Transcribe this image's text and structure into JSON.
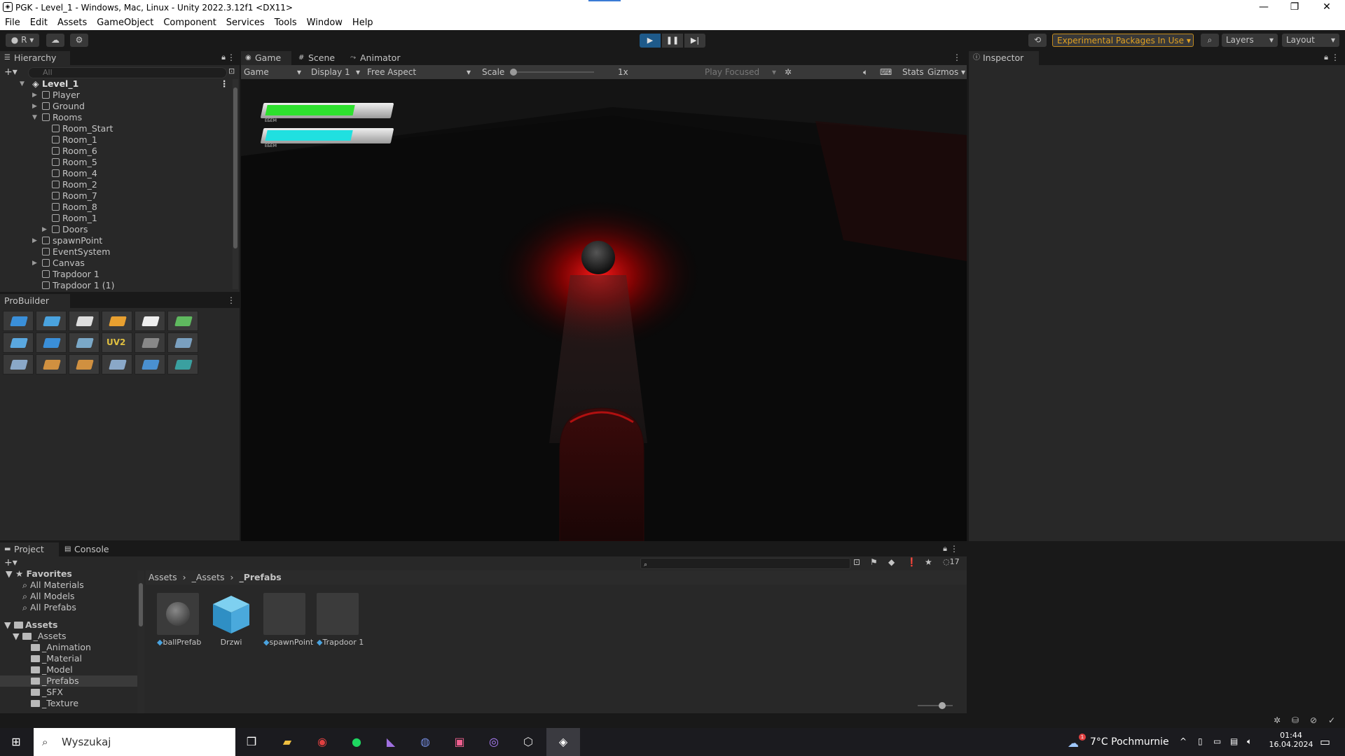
{
  "window": {
    "title": "PGK - Level_1 - Windows, Mac, Linux - Unity 2022.3.12f1 <DX11>",
    "minimize": "—",
    "restore": "❐",
    "close": "✕"
  },
  "menu": [
    "File",
    "Edit",
    "Assets",
    "GameObject",
    "Component",
    "Services",
    "Tools",
    "Window",
    "Help"
  ],
  "toolbar": {
    "account": "R",
    "experimental": "Experimental Packages In Use",
    "layers": "Layers",
    "layout": "Layout"
  },
  "hierarchy": {
    "tab": "Hierarchy",
    "search_placeholder": "All",
    "scene": "Level_1",
    "items": [
      {
        "label": "Player",
        "indent": 1,
        "arrow": "▶"
      },
      {
        "label": "Ground",
        "indent": 1,
        "arrow": "▶"
      },
      {
        "label": "Rooms",
        "indent": 1,
        "arrow": "▼"
      },
      {
        "label": "Room_Start",
        "indent": 2,
        "arrow": ""
      },
      {
        "label": "Room_1",
        "indent": 2,
        "arrow": ""
      },
      {
        "label": "Room_6",
        "indent": 2,
        "arrow": ""
      },
      {
        "label": "Room_5",
        "indent": 2,
        "arrow": ""
      },
      {
        "label": "Room_4",
        "indent": 2,
        "arrow": ""
      },
      {
        "label": "Room_2",
        "indent": 2,
        "arrow": ""
      },
      {
        "label": "Room_7",
        "indent": 2,
        "arrow": ""
      },
      {
        "label": "Room_8",
        "indent": 2,
        "arrow": ""
      },
      {
        "label": "Room_1",
        "indent": 2,
        "arrow": ""
      },
      {
        "label": "Doors",
        "indent": 2,
        "arrow": "▶"
      },
      {
        "label": "spawnPoint",
        "indent": 1,
        "arrow": "▶"
      },
      {
        "label": "EventSystem",
        "indent": 1,
        "arrow": ""
      },
      {
        "label": "Canvas",
        "indent": 1,
        "arrow": "▶"
      },
      {
        "label": "Trapdoor 1",
        "indent": 1,
        "arrow": ""
      },
      {
        "label": "Trapdoor 1 (1)",
        "indent": 1,
        "arrow": ""
      }
    ]
  },
  "probuilder": {
    "title": "ProBuilder",
    "uv_label": "UV2"
  },
  "game": {
    "tabs": [
      "Game",
      "Scene",
      "Animator"
    ],
    "view": "Game",
    "display": "Display 1",
    "aspect": "Free Aspect",
    "scale_label": "Scale",
    "scale_value": "1x",
    "play_focused": "Play Focused",
    "stats": "Stats",
    "gizmos": "Gizmos",
    "health_fill": 0.72,
    "energy_fill": 0.7,
    "bar_caption": "ЕБЕМ"
  },
  "inspector": {
    "tab": "Inspector"
  },
  "project": {
    "tabs": [
      "Project",
      "Console"
    ],
    "hidden_count": "17",
    "breadcrumb": [
      "Assets",
      "_Assets",
      "_Prefabs"
    ],
    "favorites": {
      "title": "Favorites",
      "items": [
        "All Materials",
        "All Models",
        "All Prefabs"
      ]
    },
    "assets_root": "Assets",
    "assets_sub": "_Assets",
    "folders": [
      "_Animation",
      "_Material",
      "_Model",
      "_Prefabs",
      "_SFX",
      "_Texture"
    ],
    "files": [
      "ballPrefab",
      "Drzwi",
      "spawnPoint",
      "Trapdoor 1"
    ]
  },
  "taskbar": {
    "search_placeholder": "Wyszukaj",
    "weather": "7°C Pochmurnie",
    "time": "01:44",
    "date": "16.04.2024",
    "notif_badge": "1"
  }
}
